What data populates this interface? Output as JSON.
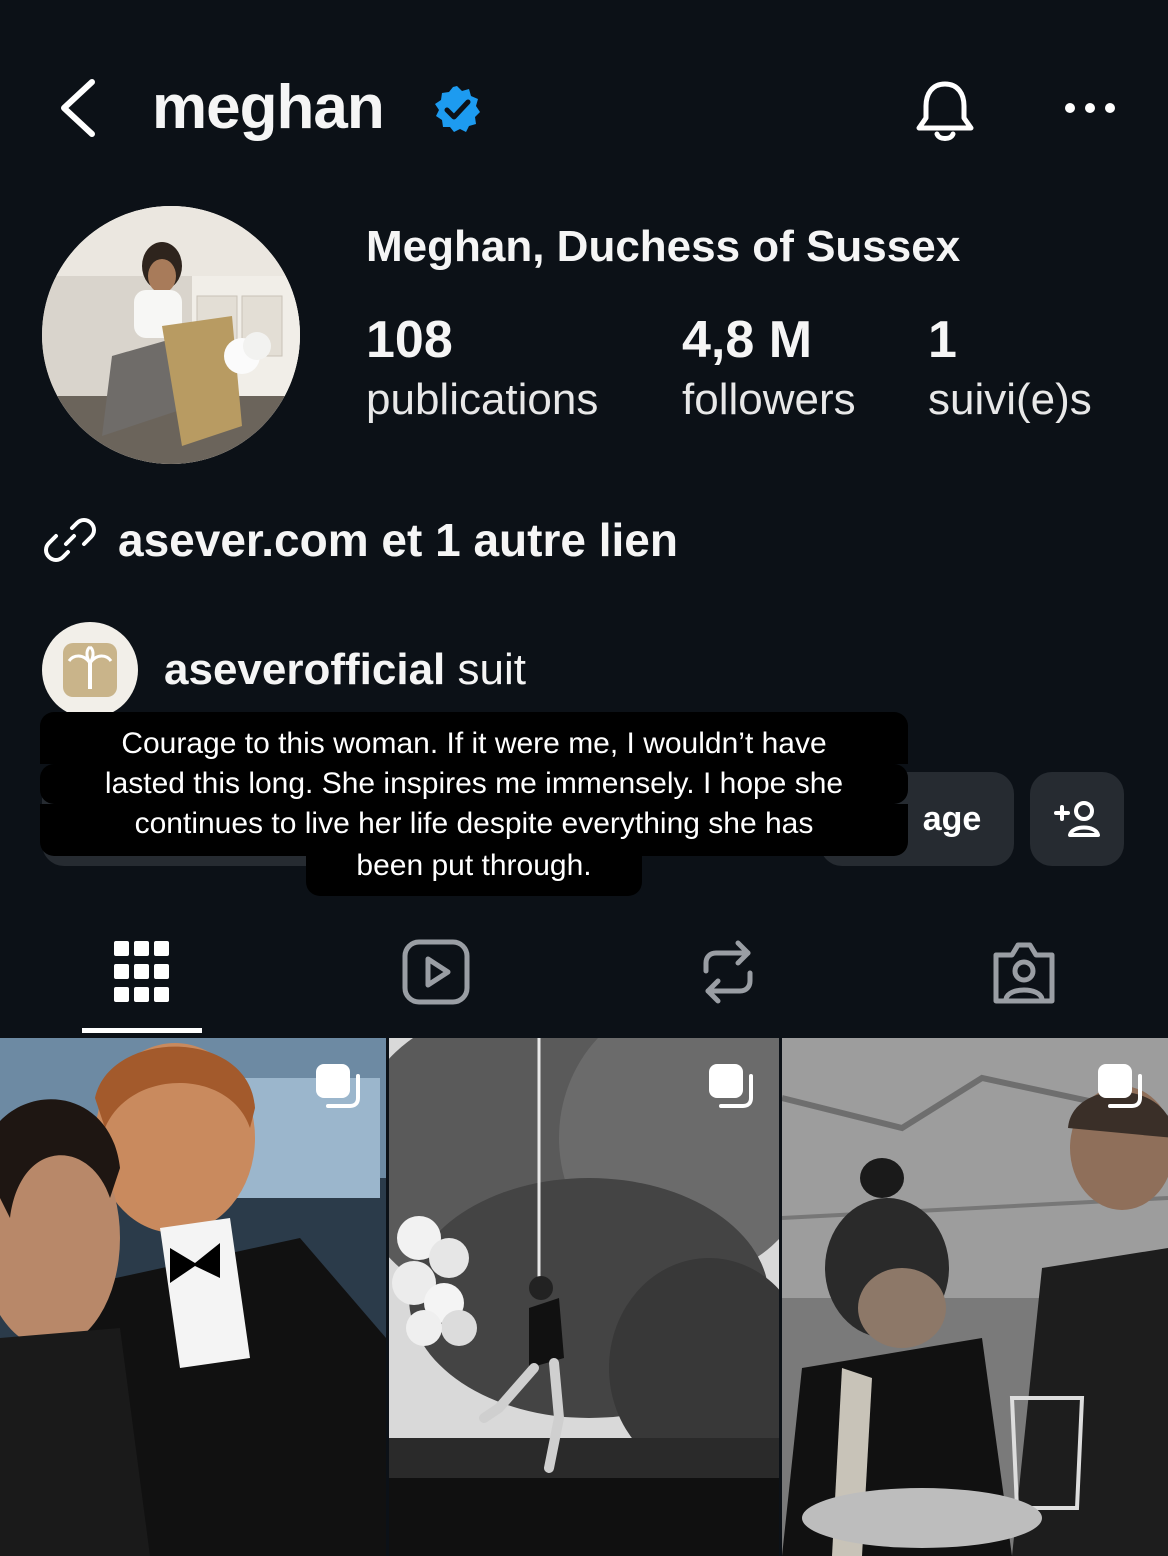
{
  "header": {
    "username": "meghan",
    "verified": true,
    "back_icon": "chevron-left-icon",
    "bell_icon": "bell-icon",
    "more_icon": "more-horizontal-icon"
  },
  "profile": {
    "full_name": "Meghan, Duchess of Sussex",
    "stats": [
      {
        "value": "108",
        "label": "publications"
      },
      {
        "value": "4,8 M",
        "label": "followers"
      },
      {
        "value": "1",
        "label": "suivi(e)s"
      }
    ],
    "link_text": "asever.com et 1 autre lien",
    "followed_by": {
      "account": "aseverofficial",
      "suffix": "suit"
    }
  },
  "actions": {
    "message_label_partial": "age",
    "add_person_icon": "add-person-icon"
  },
  "caption_overlay": {
    "lines": [
      "Courage to this woman. If it were me, I wouldn’t have",
      "lasted this long. She inspires me immensely. I hope she",
      "continues to live her life despite everything she has",
      "been put through."
    ]
  },
  "tabs": [
    {
      "name": "grid",
      "icon": "grid-icon",
      "active": true
    },
    {
      "name": "reels",
      "icon": "reels-icon",
      "active": false
    },
    {
      "name": "reposts",
      "icon": "repost-icon",
      "active": false
    },
    {
      "name": "tagged",
      "icon": "tagged-icon",
      "active": false
    }
  ],
  "colors": {
    "background": "#0c1117",
    "verified_blue": "#1d9bf0",
    "button_bg": "#262b31"
  }
}
